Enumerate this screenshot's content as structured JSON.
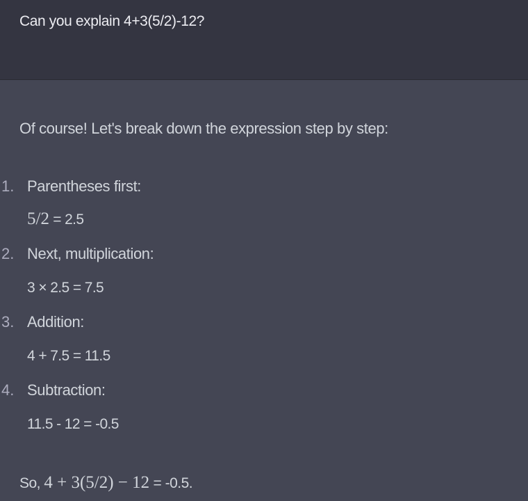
{
  "user_message": "Can you explain 4+3(5/2)-12?",
  "assistant": {
    "intro": "Of course! Let's break down the expression step by step:",
    "steps": [
      {
        "num": "1.",
        "label": "Parentheses first:",
        "math_tex": "5/2",
        "math_rest": " = 2.5"
      },
      {
        "num": "2.",
        "label": "Next, multiplication:",
        "math": "3 × 2.5 = 7.5"
      },
      {
        "num": "3.",
        "label": "Addition:",
        "math": "4 + 7.5 = 11.5"
      },
      {
        "num": "4.",
        "label": "Subtraction:",
        "math": "11.5 - 12 = -0.5"
      }
    ],
    "conclusion_prefix": "So, ",
    "conclusion_tex": "4 + 3(5/2) − 12",
    "conclusion_suffix": " = -0.5."
  },
  "colors": {
    "user_bg": "#343541",
    "assistant_bg": "#444654",
    "text": "#ececf1"
  }
}
